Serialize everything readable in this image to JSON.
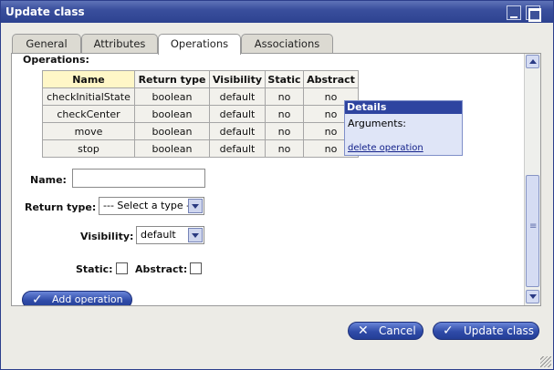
{
  "window": {
    "title": "Update class"
  },
  "tabs": [
    {
      "label": "General"
    },
    {
      "label": "Attributes"
    },
    {
      "label": "Operations",
      "active": true
    },
    {
      "label": "Associations"
    }
  ],
  "operations": {
    "section_label": "Operations:",
    "columns": [
      "Name",
      "Return type",
      "Visibility",
      "Static",
      "Abstract"
    ],
    "rows": [
      {
        "name": "checkInitialState",
        "return_type": "boolean",
        "visibility": "default",
        "static": "no",
        "abstract": "no"
      },
      {
        "name": "checkCenter",
        "return_type": "boolean",
        "visibility": "default",
        "static": "no",
        "abstract": "no"
      },
      {
        "name": "move",
        "return_type": "boolean",
        "visibility": "default",
        "static": "no",
        "abstract": "no"
      },
      {
        "name": "stop",
        "return_type": "boolean",
        "visibility": "default",
        "static": "no",
        "abstract": "no"
      }
    ]
  },
  "details": {
    "title": "Details",
    "arguments_label": "Arguments:",
    "delete_link": "delete operation"
  },
  "form": {
    "name_label": "Name:",
    "name_value": "",
    "return_type_label": "Return type:",
    "return_type_value": "--- Select a type ---",
    "visibility_label": "Visibility:",
    "visibility_value": "default",
    "static_label": "Static:",
    "static_checked": false,
    "abstract_label": "Abstract:",
    "abstract_checked": false,
    "add_button": "Add operation"
  },
  "footer": {
    "cancel": "Cancel",
    "update": "Update class"
  },
  "colors": {
    "title_bar": "#2d4290",
    "button": "#2f4ba8",
    "header_highlight": "#fff7c7"
  }
}
